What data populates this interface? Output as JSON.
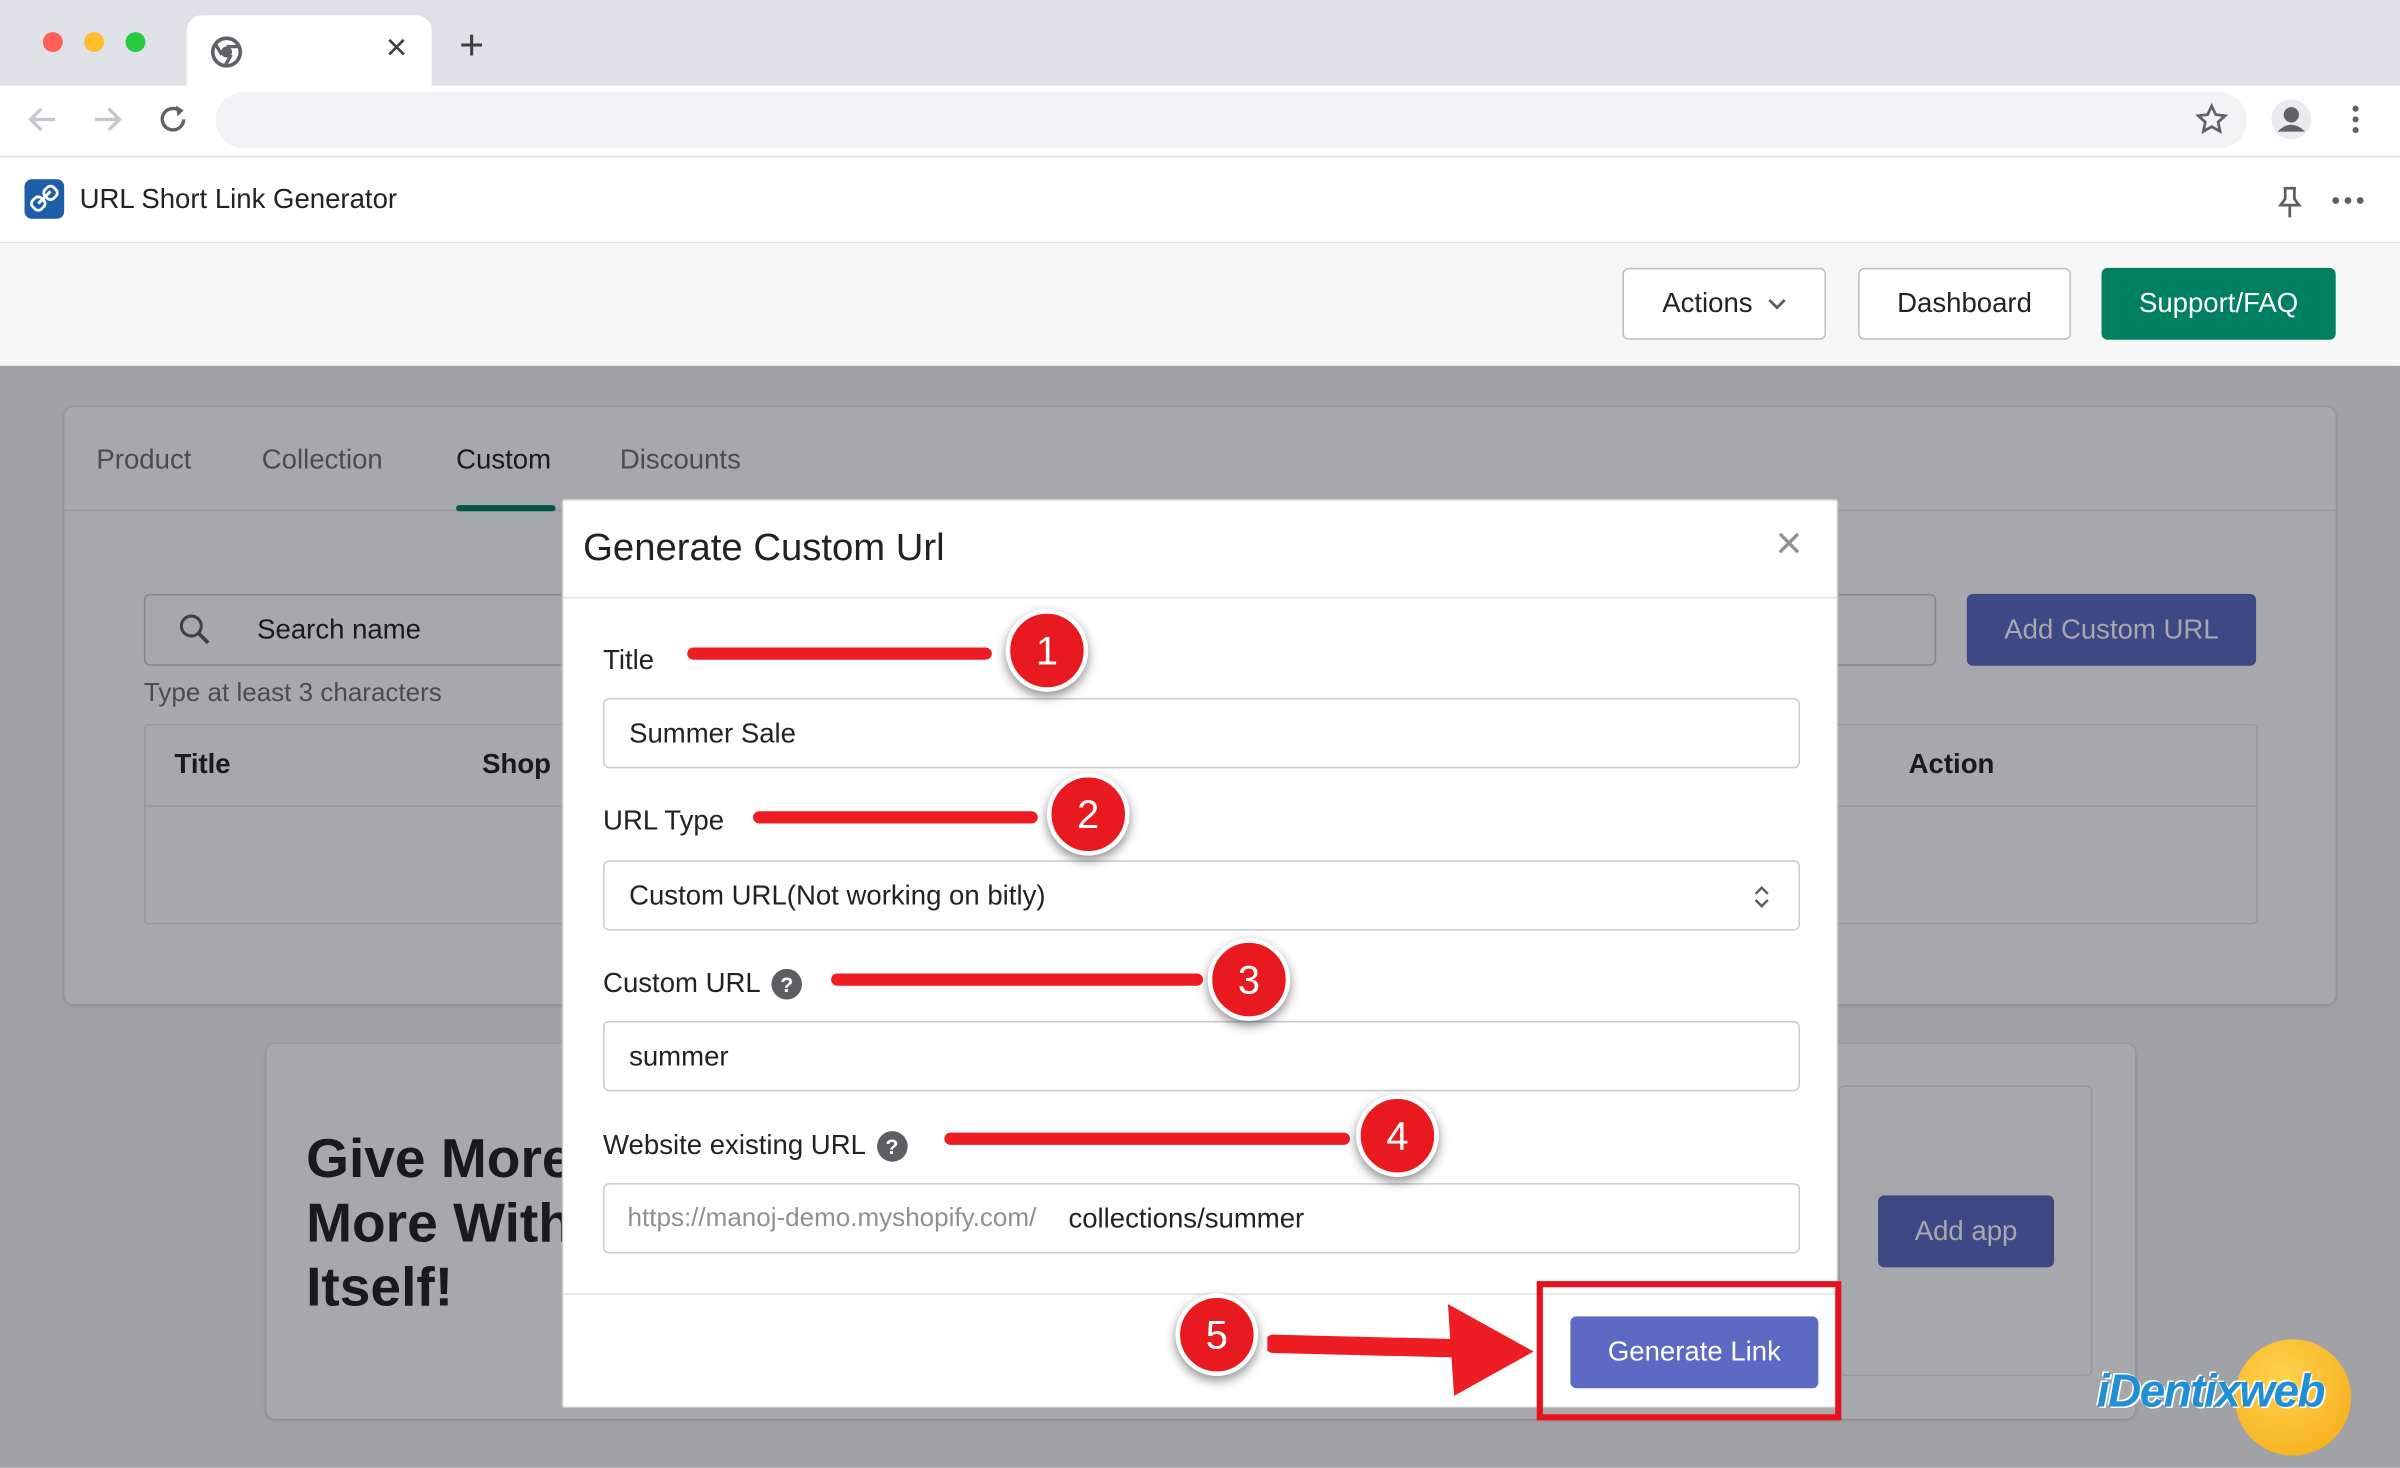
{
  "browser": {
    "controls": [
      "close-light",
      "minimize-light",
      "maximize-light"
    ],
    "tab_close": "×",
    "new_tab": "+",
    "colors": {
      "red": "#ff5f57",
      "yellow": "#febc2e",
      "green": "#28c840"
    }
  },
  "app": {
    "title": "URL Short Link Generator",
    "actions_label": "Actions",
    "dashboard_label": "Dashboard",
    "support_label": "Support/FAQ",
    "accent": "#008060",
    "primary": "#5c6ac4"
  },
  "tabs": [
    {
      "label": "Product"
    },
    {
      "label": "Collection"
    },
    {
      "label": "Custom",
      "selected": true
    },
    {
      "label": "Discounts"
    }
  ],
  "list": {
    "search_placeholder": "Search name",
    "hint": "Type at least 3 characters",
    "add_button": "Add Custom URL",
    "columns": [
      "Title",
      "Shop",
      "Action"
    ]
  },
  "promo": {
    "heading_line1": "Give More",
    "heading_line2": "More With",
    "heading_line3": "Itself!",
    "add_app": "Add app"
  },
  "modal": {
    "title": "Generate Custom Url",
    "close": "×",
    "title_label": "Title",
    "title_value": "Summer Sale",
    "url_type_label": "URL Type",
    "url_type_value": "Custom URL(Not working on bitly)",
    "custom_url_label": "Custom URL",
    "custom_url_value": "summer",
    "website_url_label": "Website existing URL",
    "website_url_prefix": "https://manoj-demo.myshopify.com/",
    "website_url_value": "collections/summer",
    "generate_button": "Generate Link",
    "help_glyph": "?"
  },
  "annotations": {
    "steps": [
      "1",
      "2",
      "3",
      "4",
      "5"
    ],
    "color": "#e81a1f"
  },
  "watermark": {
    "text": "iDentixweb"
  }
}
